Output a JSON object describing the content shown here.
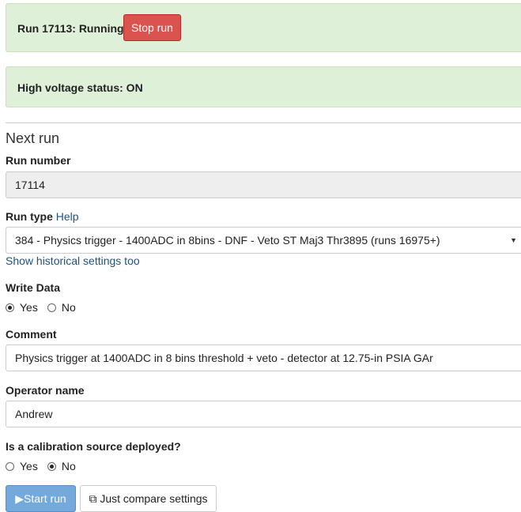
{
  "status": {
    "run_text": "Run 17113: Running",
    "stop_button": "Stop run",
    "hv_text": "High voltage status: ON"
  },
  "form": {
    "legend": "Next run",
    "run_number": {
      "label": "Run number",
      "value": "17114"
    },
    "run_type": {
      "label": "Run type",
      "help": "Help",
      "value": "384 - Physics trigger - 1400ADC in 8bins - DNF - Veto ST Maj3 Thr3895 (runs 16975+)",
      "show_historical": "Show historical settings too"
    },
    "write_data": {
      "label": "Write Data",
      "options": [
        "Yes",
        "No"
      ],
      "selected": "Yes"
    },
    "comment": {
      "label": "Comment",
      "value": "Physics trigger at 1400ADC in 8 bins threshold + veto - detector at 12.75-in PSIA GAr"
    },
    "operator": {
      "label": "Operator name",
      "value": "Andrew"
    },
    "calibration": {
      "label": "Is a calibration source deployed?",
      "options": [
        "Yes",
        "No"
      ],
      "selected": "No"
    },
    "start_button": "Start run",
    "compare_button": "Just compare settings"
  },
  "icons": {
    "start": "play-icon",
    "compare": "copy-icon",
    "select": "caret-down-icon"
  },
  "colors": {
    "alert_bg": "#dff0d8",
    "danger": "#d9534f",
    "primary": "#5b9bd5",
    "link": "#23527c"
  }
}
